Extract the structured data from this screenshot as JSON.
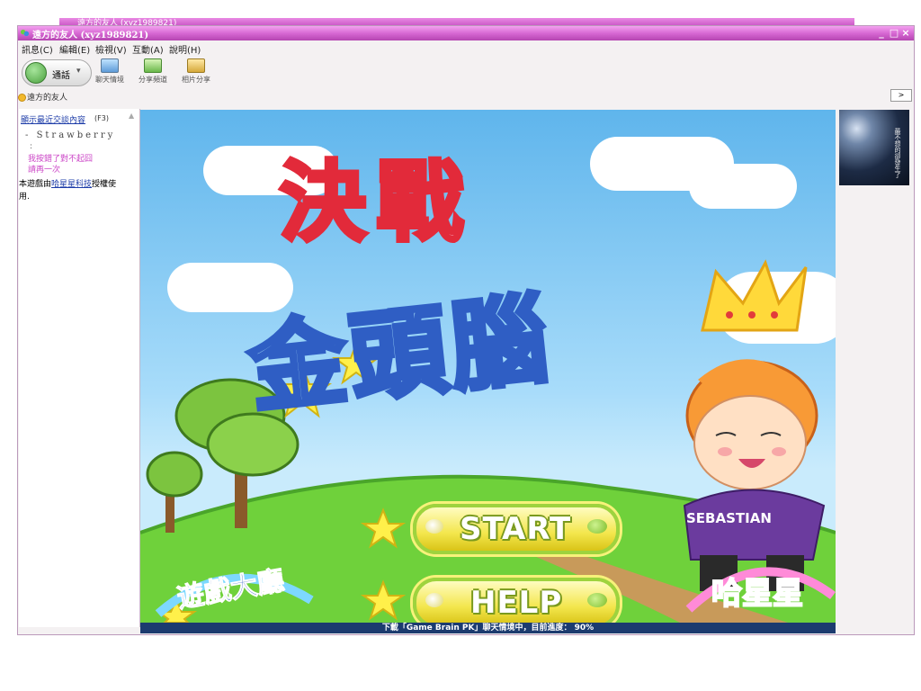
{
  "ghost_window": {
    "title": "遠方的友人 (xyz1989821)"
  },
  "window": {
    "title": "遠方的友人 (xyz1989821)",
    "controls": {
      "minimize": "_",
      "maximize": "□",
      "close": "×"
    }
  },
  "menu": [
    "訊息(C)",
    "編輯(E)",
    "檢視(V)",
    "互動(A)",
    "說明(H)"
  ],
  "toolbar": {
    "call_label": "通話",
    "items": [
      {
        "label": "聊天情境",
        "icon": "monitor-icon"
      },
      {
        "label": "分享頻道",
        "icon": "share-icon"
      },
      {
        "label": "相片分享",
        "icon": "photo-icon"
      }
    ]
  },
  "contact": {
    "name": "遠方的友人",
    "status_color": "#f2b92c",
    "expand_label": ">"
  },
  "chat": {
    "recent_link": "顯示最近交談內容",
    "recent_key": "(F3)",
    "user": "Strawberry",
    "colon": ":",
    "messages": [
      "我按錯了對不起囧",
      "請再一次"
    ],
    "system_pre": "本遊戲由",
    "system_link": "哈星星科技",
    "system_post": "授權使",
    "system_line2": "用."
  },
  "game": {
    "title_line1": "決戰",
    "title_line2": "金頭腦",
    "start_label": "START",
    "help_label": "HELP",
    "lobby_label": "遊戲大廳",
    "brand_label": "哈星星",
    "shirt_label": "SEBASTIAN",
    "status": "下載「Game Brain PK」聊天情境中，目前進度： 90%",
    "progress_percent": 90
  },
  "avatar": {
    "caption": "最不想的卻發生了"
  },
  "colors": {
    "titlebar": "#d768d3",
    "sky": "#5fb5ec",
    "grass": "#6fd13b",
    "button_yellow": "#f3e64c"
  }
}
